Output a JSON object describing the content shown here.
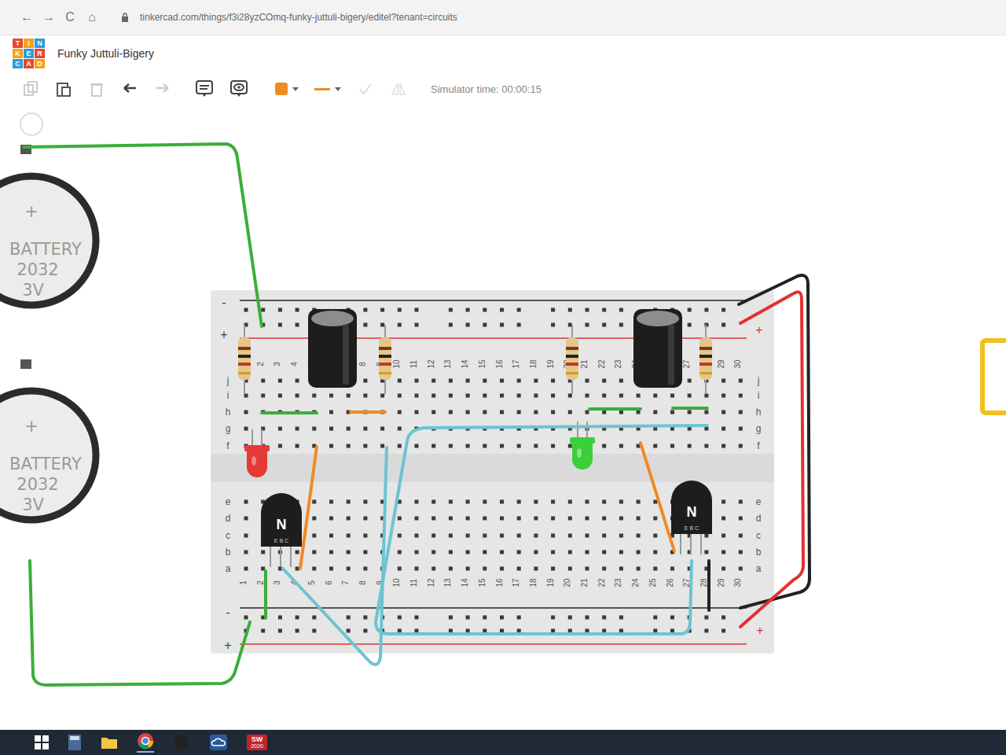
{
  "browser": {
    "nav": [
      "←",
      "→",
      "C",
      "⌂"
    ],
    "url": "tinkercad.com/things/f3i28yzCOmq-funky-juttuli-bigery/editel?tenant=circuits"
  },
  "app": {
    "logo": [
      "TIN",
      "KER",
      "CAD"
    ],
    "title": "Funky Juttuli-Bigery",
    "simulator_time": "Simulator time: 00:00:15"
  },
  "breadboard": {
    "columns": [
      "1",
      "2",
      "3",
      "4",
      "5",
      "6",
      "7",
      "8",
      "9",
      "10",
      "11",
      "12",
      "13",
      "14",
      "15",
      "16",
      "17",
      "18",
      "19",
      "20",
      "21",
      "22",
      "23",
      "24",
      "25",
      "26",
      "27",
      "28",
      "29",
      "30"
    ],
    "rows_top": [
      "j",
      "i",
      "h",
      "g",
      "f"
    ],
    "rows_bottom": [
      "e",
      "d",
      "c",
      "b",
      "a"
    ],
    "plus": "+",
    "minus": "-"
  },
  "batteries": [
    {
      "plus": "+",
      "label": "BATTERY",
      "model": "2032",
      "voltage": "3V"
    },
    {
      "plus": "+",
      "label": "BATTERY",
      "model": "2032",
      "voltage": "3V"
    }
  ],
  "leds": [
    {
      "color": "#e53935"
    },
    {
      "color": "#3ccf3c"
    }
  ],
  "transistors": [
    {
      "label": "N",
      "pins": "E B C"
    },
    {
      "label": "N",
      "pins": "E B C"
    }
  ],
  "wires": [
    {
      "color": "#3aae3a"
    },
    {
      "color": "#3aae3a"
    },
    {
      "color": "#3aae3a"
    },
    {
      "color": "#3aae3a"
    },
    {
      "color": "#f08a24"
    },
    {
      "color": "#3aae3a"
    },
    {
      "color": "#3aae3a"
    },
    {
      "color": "#f08a24"
    },
    {
      "color": "#f08a24"
    },
    {
      "color": "#6cc4d0"
    },
    {
      "color": "#6cc4d0"
    },
    {
      "color": "#222222"
    },
    {
      "color": "#222222"
    },
    {
      "color": "#e53030"
    }
  ],
  "taskbar": {
    "sw_label": "SW",
    "sw_year": "2020"
  }
}
